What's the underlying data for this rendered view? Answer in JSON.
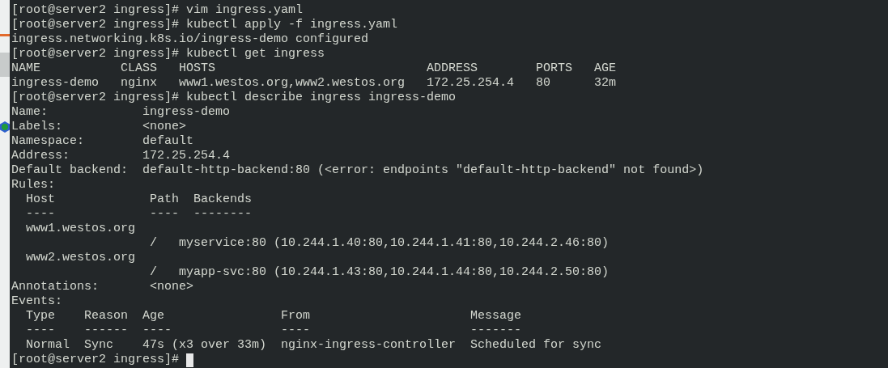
{
  "terminal": {
    "lines": [
      "[root@server2 ingress]# vim ingress.yaml",
      "[root@server2 ingress]# kubectl apply -f ingress.yaml",
      "ingress.networking.k8s.io/ingress-demo configured",
      "[root@server2 ingress]# kubectl get ingress",
      "NAME           CLASS   HOSTS                             ADDRESS        PORTS   AGE",
      "ingress-demo   nginx   www1.westos.org,www2.westos.org   172.25.254.4   80      32m",
      "[root@server2 ingress]# kubectl describe ingress ingress-demo",
      "Name:             ingress-demo",
      "Labels:           <none>",
      "Namespace:        default",
      "Address:          172.25.254.4",
      "Default backend:  default-http-backend:80 (<error: endpoints \"default-http-backend\" not found>)",
      "Rules:",
      "  Host             Path  Backends",
      "  ----             ----  --------",
      "  www1.westos.org",
      "                   /   myservice:80 (10.244.1.40:80,10.244.1.41:80,10.244.2.46:80)",
      "  www2.westos.org",
      "                   /   myapp-svc:80 (10.244.1.43:80,10.244.1.44:80,10.244.2.50:80)",
      "Annotations:       <none>",
      "Events:",
      "  Type    Reason  Age                From                      Message",
      "  ----    ------  ----               ----                      -------",
      "  Normal  Sync    47s (x3 over 33m)  nginx-ingress-controller  Scheduled for sync",
      "[root@server2 ingress]#"
    ],
    "cursor_visible": true
  }
}
